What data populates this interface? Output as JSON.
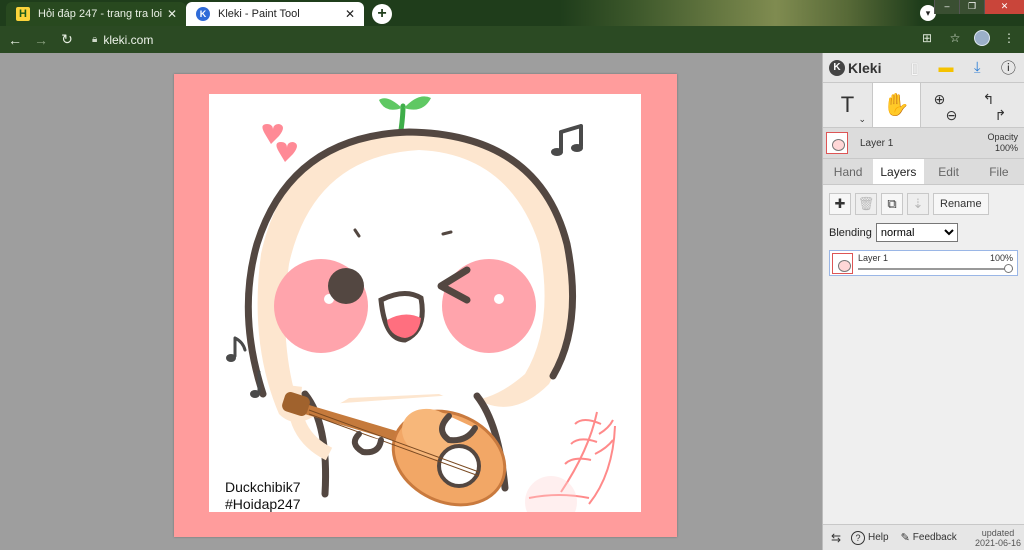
{
  "browser": {
    "tabs": [
      {
        "title": "Hỏi đáp 247 - trang tra loi",
        "favicon": "H",
        "active": false
      },
      {
        "title": "Kleki - Paint Tool",
        "favicon": "K",
        "active": true
      }
    ],
    "new_tab": "+",
    "url": "kleki.com"
  },
  "canvas": {
    "signature_line1": "Duckchibik7",
    "signature_line2": "#Hoidap247",
    "frame_color": "#ff9c9c"
  },
  "panel": {
    "logo": "Kleki",
    "toolbar_icons": [
      "new-image-icon",
      "open-folder-icon",
      "download-icon",
      "help-icon"
    ],
    "tools": [
      "text-tool-icon",
      "hand-tool-icon",
      "zoom-in-icon",
      "zoom-out-icon",
      "undo-icon",
      "redo-icon"
    ],
    "layer_name": "Layer 1",
    "opacity_label": "Opacity",
    "opacity_value": "100%",
    "tabs": [
      "Hand",
      "Layers",
      "Edit",
      "File"
    ],
    "active_tab": "Layers",
    "rename_label": "Rename",
    "blending_label": "Blending",
    "blending_value": "normal",
    "layers": [
      {
        "name": "Layer 1",
        "opacity": "100%"
      }
    ],
    "help_label": "Help",
    "feedback_label": "Feedback",
    "updated_label": "updated",
    "updated_date": "2021-06-16"
  }
}
